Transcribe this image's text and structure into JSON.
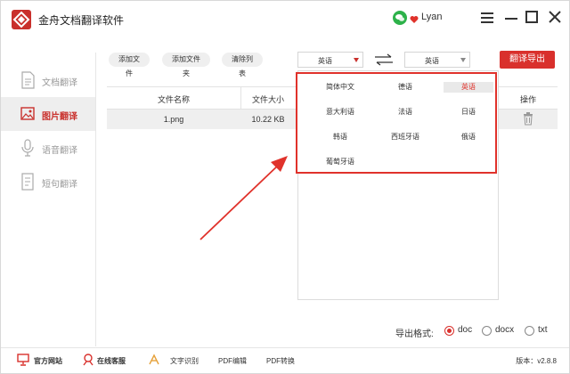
{
  "app": {
    "title": "金舟文档翻译软件",
    "user": "Lyan"
  },
  "sidebar": {
    "items": [
      {
        "label": "文档翻译",
        "active": false
      },
      {
        "label": "图片翻译",
        "active": true
      },
      {
        "label": "语音翻译",
        "active": false
      },
      {
        "label": "短句翻译",
        "active": false
      }
    ]
  },
  "toolbar": {
    "add_file": "添加文件",
    "add_folder": "添加文件夹",
    "clear_list": "清除列表",
    "source_lang": "英语",
    "target_lang": "英语",
    "export": "翻译导出"
  },
  "table": {
    "headers": {
      "name": "文件名称",
      "size": "文件大小",
      "action": "操作"
    },
    "rows": [
      {
        "name": "1.png",
        "size": "10.22 KB"
      }
    ]
  },
  "lang_panel": {
    "options": [
      "简体中文",
      "德语",
      "英语",
      "意大利语",
      "法语",
      "日语",
      "韩语",
      "西班牙语",
      "俄语",
      "葡萄牙语"
    ],
    "selected": "英语"
  },
  "export_format": {
    "label": "导出格式:",
    "options": [
      "doc",
      "docx",
      "txt"
    ],
    "selected": "doc"
  },
  "footer": {
    "website": "官方网站",
    "service": "在线客服",
    "ocr": "文字识别",
    "pdf_edit": "PDF编辑",
    "pdf_convert": "PDF转换",
    "version": "版本：v2.8.8"
  },
  "colors": {
    "accent": "#d9302c",
    "highlight_box": "#e0322b"
  }
}
